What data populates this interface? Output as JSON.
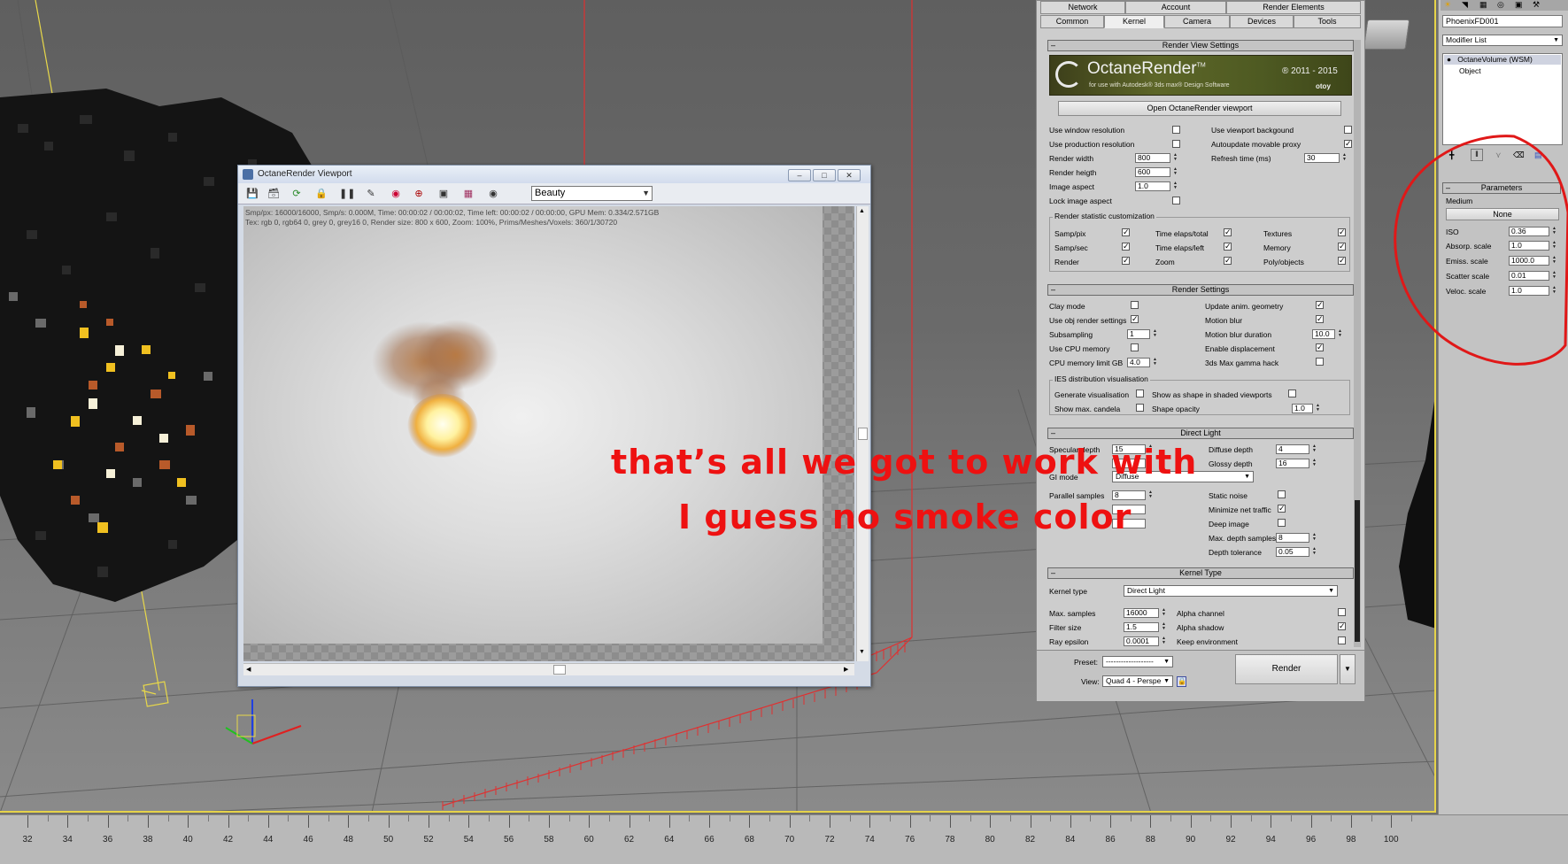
{
  "octane_viewport": {
    "title": "OctaneRender Viewport",
    "pass_select": "Beauty",
    "stats_line1": "Smp/px: 16000/16000,   Smp/s: 0.000M,   Time: 00:00:02 / 00:00:02,   Time left: 00:00:02 / 00:00:00,   GPU Mem: 0.334/2.571GB",
    "stats_line2": "Tex: rgb 0, rgb64 0, grey 0, grey16 0,   Render size: 800 x 600,   Zoom: 100%,   Prims/Meshes/Voxels: 360/1/30720",
    "toolbar_icons": [
      "save-icon",
      "save-all-icon",
      "refresh-icon",
      "lock-icon",
      "pause-icon",
      "region-icon",
      "color-picker-icon",
      "focus-icon",
      "viewport-icon",
      "material-icon",
      "camera-icon"
    ]
  },
  "render_setup": {
    "tabs_top": [
      "Network",
      "Account",
      "Render Elements"
    ],
    "tabs_bottom": [
      "Common",
      "Kernel",
      "Camera",
      "Devices",
      "Tools"
    ],
    "active_tab": "Kernel",
    "rvs": {
      "title": "Render View Settings",
      "logo_text": "OctaneRender",
      "logo_tm": "TM",
      "logo_sub": "for use with Autodesk® 3ds max® Design Software",
      "logo_years": "® 2011 - 2015",
      "logo_brand": "otoy",
      "open_button": "Open OctaneRender viewport",
      "use_window_resolution": "Use window resolution",
      "use_production_resolution": "Use production resolution",
      "render_width_label": "Render width",
      "render_width": "800",
      "render_height_label": "Render heigth",
      "render_height": "600",
      "image_aspect_label": "Image aspect",
      "image_aspect": "1.0",
      "lock_image_aspect": "Lock image aspect",
      "use_viewport_background": "Use viewport backgound",
      "autoupdate_proxy": "Autoupdate movable proxy",
      "refresh_time_label": "Refresh time (ms)",
      "refresh_time": "30",
      "stat_group_title": "Render statistic customization",
      "stat_items": [
        "Samp/pix",
        "Time elaps/total",
        "Textures",
        "Samp/sec",
        "Time elaps/left",
        "Memory",
        "Render",
        "Zoom",
        "Poly/objects"
      ]
    },
    "rs": {
      "title": "Render Settings",
      "clay_mode": "Clay mode",
      "use_obj_render": "Use obj render settings",
      "subsampling_label": "Subsampling",
      "subsampling": "1",
      "use_cpu_memory": "Use CPU memory",
      "cpu_mem_label": "CPU memory limit GB",
      "cpu_mem": "4.0",
      "update_anim": "Update anim. geometry",
      "motion_blur": "Motion blur",
      "motion_blur_dur_label": "Motion blur duration",
      "motion_blur_dur": "10.0",
      "enable_displacement": "Enable displacement",
      "gamma_hack": "3ds Max gamma hack",
      "ies_title": "IES distribution visualisation",
      "generate_vis": "Generate visualisation",
      "show_max_candela": "Show max. candela",
      "show_as_shape": "Show as shape in shaded viewports",
      "shape_opacity_label": "Shape opacity",
      "shape_opacity": "1.0"
    },
    "dl": {
      "title": "Direct Light",
      "specular_depth_label": "Specular depth",
      "specular_depth": "15",
      "gi_mode_label": "GI mode",
      "gi_mode": "Diffuse",
      "parallel_samples_label": "Parallel samples",
      "parallel_samples": "8",
      "diffuse_depth_label": "Diffuse depth",
      "diffuse_depth": "4",
      "glossy_depth_label": "Glossy depth",
      "glossy_depth": "16",
      "static_noise": "Static noise",
      "minimize_net": "Minimize net traffic",
      "deep_image": "Deep image",
      "max_depth_samples_label": "Max. depth samples",
      "max_depth_samples": "8",
      "depth_tolerance_label": "Depth tolerance",
      "depth_tolerance": "0.05"
    },
    "kt": {
      "title": "Kernel Type",
      "kernel_type_label": "Kernel type",
      "kernel_type": "Direct Light",
      "max_samples_label": "Max. samples",
      "max_samples": "16000",
      "filter_size_label": "Filter size",
      "filter_size": "1.5",
      "ray_epsilon_label": "Ray epsilon",
      "ray_epsilon": "0.0001",
      "alpha_channel": "Alpha channel",
      "alpha_shadow": "Alpha shadow",
      "keep_environment": "Keep environment"
    },
    "footer": {
      "preset_label": "Preset:",
      "preset_value": "-------------------",
      "view_label": "View:",
      "view_value": "Quad 4 - Perspe",
      "render_button": "Render"
    }
  },
  "command_panel": {
    "object_name": "PhoenixFD001",
    "modifier_list": "Modifier List",
    "stack_item": "OctaneVolume (WSM)",
    "stack_sub": "Object",
    "params_title": "Parameters",
    "medium_label": "Medium",
    "medium_button": "None",
    "iso_label": "ISO",
    "iso": "0.36",
    "absorp_label": "Absorp. scale",
    "absorp": "1.0",
    "emiss_label": "Emiss. scale",
    "emiss": "1000.0",
    "scatter_label": "Scatter scale",
    "scatter": "0.01",
    "veloc_label": "Veloc. scale",
    "veloc": "1.0"
  },
  "annotation": {
    "line1": "that’s all we got to work with",
    "line2": "I guess no smoke color",
    "color": "#ee1111"
  },
  "timeline": {
    "labels": [
      "32",
      "34",
      "36",
      "38",
      "40",
      "42",
      "44",
      "46",
      "48",
      "50",
      "52",
      "54",
      "56",
      "58",
      "60",
      "62",
      "64",
      "66",
      "68",
      "70",
      "72",
      "74",
      "76",
      "78",
      "80",
      "82",
      "84",
      "86",
      "88",
      "90",
      "92",
      "94",
      "96",
      "98",
      "100"
    ]
  }
}
